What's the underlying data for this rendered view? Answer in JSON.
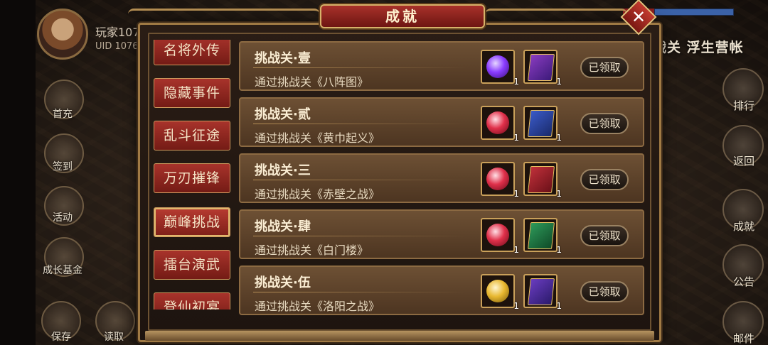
{
  "player": {
    "name": "玩家107",
    "uid": "UID 1076"
  },
  "stage_name": "战关 浮生营帐",
  "left_menu": [
    {
      "label": "首充",
      "icon": "gift-icon"
    },
    {
      "label": "签到",
      "icon": "calendar-icon"
    },
    {
      "label": "活动",
      "icon": "event-icon"
    },
    {
      "label": "成长基金",
      "icon": "fund-icon"
    },
    {
      "label": "保存",
      "icon": "save-icon"
    },
    {
      "label": "读取",
      "icon": "load-icon"
    }
  ],
  "right_menu": [
    {
      "label": "排行",
      "icon": "rank-icon"
    },
    {
      "label": "返回",
      "icon": "back-icon"
    },
    {
      "label": "成就",
      "icon": "achievement-icon"
    },
    {
      "label": "公告",
      "icon": "notice-icon"
    },
    {
      "label": "邮件",
      "icon": "mail-icon"
    }
  ],
  "dialog": {
    "title": "成就",
    "close_label": "✕",
    "tabs": [
      "名将外传",
      "隐藏事件",
      "乱斗征途",
      "万刃摧锋",
      "巅峰挑战",
      "擂台演武",
      "登仙初宴"
    ],
    "active_tab": "巅峰挑战",
    "achievements": [
      {
        "title": "挑战关·壹",
        "desc": "通过挑战关《八阵图》",
        "rewards": [
          {
            "type": "purple-gem",
            "qty": "1"
          },
          {
            "type": "purple-book",
            "qty": "1"
          }
        ],
        "status": "已领取"
      },
      {
        "title": "挑战关·贰",
        "desc": "通过挑战关《黄巾起义》",
        "rewards": [
          {
            "type": "red-gem",
            "qty": "1"
          },
          {
            "type": "blue-book",
            "qty": "1"
          }
        ],
        "status": "已领取"
      },
      {
        "title": "挑战关·三",
        "desc": "通过挑战关《赤壁之战》",
        "rewards": [
          {
            "type": "red-gem",
            "qty": "1"
          },
          {
            "type": "red-book",
            "qty": "1"
          }
        ],
        "status": "已领取"
      },
      {
        "title": "挑战关·肆",
        "desc": "通过挑战关《白门楼》",
        "rewards": [
          {
            "type": "red-gem",
            "qty": "1"
          },
          {
            "type": "green-book",
            "qty": "1"
          }
        ],
        "status": "已领取"
      },
      {
        "title": "挑战关·伍",
        "desc": "通过挑战关《洛阳之战》",
        "rewards": [
          {
            "type": "gold-gem",
            "qty": "1"
          },
          {
            "type": "purple-book",
            "qty": "1"
          }
        ],
        "status": "已领取"
      }
    ]
  },
  "colors": {
    "accent_red": "#a8312a",
    "gold_border": "#d7b26a",
    "row_bg": "#6d5034"
  }
}
